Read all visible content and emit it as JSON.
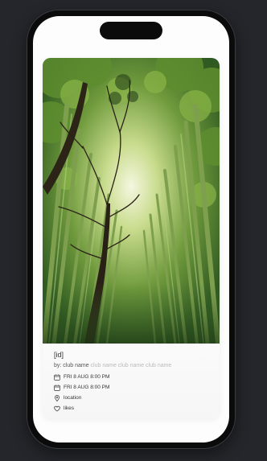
{
  "event": {
    "title": "[id]",
    "by_prefix": "by:",
    "club_name": "club name",
    "club_name_extra": "club name club name club name",
    "start_date": "FRI 8 AUG 8:00 PM",
    "end_date": "FRI 8 AUG 8:00 PM",
    "location": "location",
    "likes": "likes"
  },
  "icons": {
    "calendar_start": "calendar-icon",
    "calendar_end": "calendar-icon",
    "location": "map-pin-icon",
    "likes": "heart-icon"
  }
}
